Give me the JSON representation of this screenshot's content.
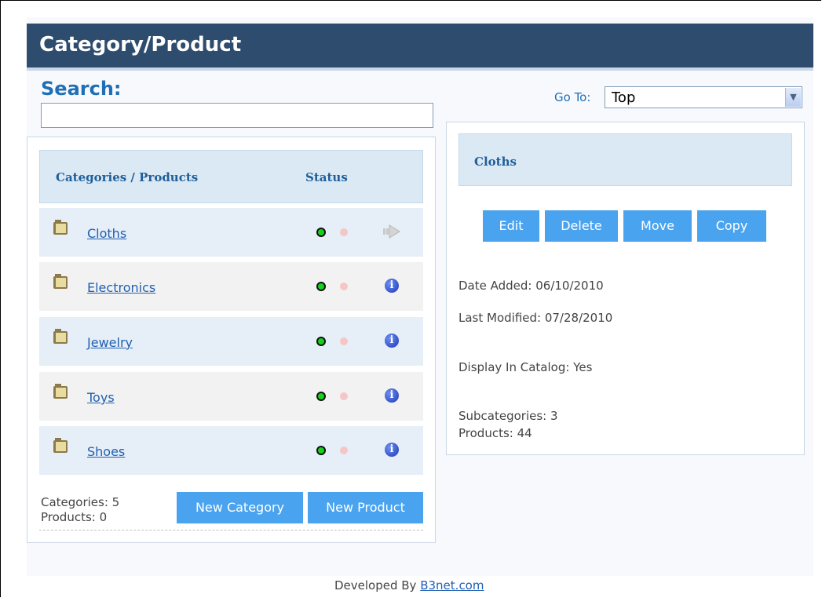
{
  "header": {
    "title": "Category/Product"
  },
  "search": {
    "label": "Search:",
    "value": "",
    "placeholder": ""
  },
  "goto": {
    "label": "Go To:",
    "selected": "Top"
  },
  "list": {
    "col_name": "Categories / Products",
    "col_status": "Status",
    "rows": [
      {
        "name": "Cloths",
        "active": true,
        "action_icon": "arrow-right-icon"
      },
      {
        "name": "Electronics",
        "active": true,
        "action_icon": "info-icon"
      },
      {
        "name": "Jewelry",
        "active": true,
        "action_icon": "info-icon"
      },
      {
        "name": "Toys",
        "active": true,
        "action_icon": "info-icon"
      },
      {
        "name": "Shoes",
        "active": true,
        "action_icon": "info-icon"
      }
    ],
    "categories_count": "Categories: 5",
    "products_count": "Products: 0",
    "new_category_label": "New Category",
    "new_product_label": "New Product"
  },
  "detail": {
    "title": "Cloths",
    "edit_label": "Edit",
    "delete_label": "Delete",
    "move_label": "Move",
    "copy_label": "Copy",
    "date_added": "Date Added: 06/10/2010",
    "last_modified": "Last Modified: 07/28/2010",
    "display_in_catalog": "Display In Catalog: Yes",
    "subcategories": "Subcategories: 3",
    "products": "Products: 44"
  },
  "footer": {
    "prefix": "Developed By ",
    "link_text": "B3net.com"
  },
  "colors": {
    "title_bar": "#2e4c6d",
    "accent": "#1f6fb6",
    "button": "#4aa3ef",
    "status_on": "#15d21a",
    "status_off": "#f5c6c6"
  }
}
